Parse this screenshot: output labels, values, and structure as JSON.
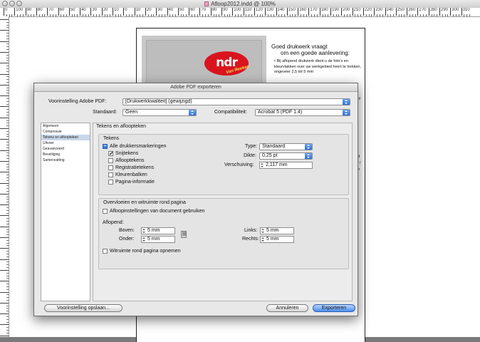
{
  "window": {
    "title": "Afloop2012.indd @ 100%"
  },
  "ruler": {
    "labels": [
      "0",
      "100",
      "90",
      "80",
      "70",
      "60",
      "50",
      "40",
      "30",
      "20",
      "10",
      "0",
      "10",
      "20",
      "30",
      "40",
      "50",
      "60",
      "70",
      "80",
      "90",
      "100",
      "110",
      "120",
      "130",
      "140",
      "150",
      "160",
      "170",
      "180",
      "190",
      "200",
      "210",
      "220",
      "230",
      "240",
      "250",
      "260",
      "270",
      "280",
      "290",
      "300",
      "310"
    ]
  },
  "document": {
    "heading_line1": "Goed drukwerk vraagt",
    "heading_line2": "om een goede aanlevering:",
    "body": "• Bij aflopend drukwerk dient u de foto's en kleurvlakken over uw werkgebied heen te trekken, ongeveer 2,5 tot 5 mm",
    "logo_text": "ndr",
    "logo_sub": "Van Reeken",
    "edge_fragments": [
      "n!",
      "d",
      "f /",
      "n"
    ]
  },
  "dialog": {
    "title": "Adobe PDF exporteren",
    "preset_label": "Voorinstelling Adobe PDF:",
    "preset_value": "[Drukwerkkwaliteit] (gewijzigd)",
    "standard_label": "Standaard:",
    "standard_value": "Geen",
    "compat_label": "Compatibiliteit:",
    "compat_value": "Acrobat 5 (PDF 1.4)",
    "sidebar": [
      "Algemeen",
      "Compressie",
      "Tekens en afloopteken",
      "Uitvoer",
      "Geavanceerd",
      "Beveiliging",
      "Samenvatting"
    ],
    "selected_sidebar_index": 2,
    "section_title": "Tekens en afloopteken",
    "marks": {
      "group_title": "Tekens",
      "all_marks": "Alle drukkersmarkeringen",
      "crop_marks": "Snijtekens",
      "bleed_marks": "Aflooptekens",
      "registration": "Registratietekens",
      "color_bars": "Kleurenbalken",
      "page_info": "Pagina-informatie",
      "type_label": "Type:",
      "type_value": "Standaard",
      "weight_label": "Dikte:",
      "weight_value": "0,25 pt",
      "offset_label": "Verschuiving:",
      "offset_value": "2,117 mm"
    },
    "bleed": {
      "group_title": "Overvloeien en witruimte rond pagina",
      "use_doc": "Afloopinstellingen van document gebruiken",
      "bleed_label": "Aflopend:",
      "top_label": "Boven:",
      "top_value": "5 mm",
      "bottom_label": "Onder:",
      "bottom_value": "5 mm",
      "left_label": "Links:",
      "left_value": "5 mm",
      "right_label": "Rechts:",
      "right_value": "5 mm",
      "slug": "Witruimte rond pagina opnemen"
    },
    "buttons": {
      "save_preset": "Voorinstelling opslaan...",
      "cancel": "Annuleren",
      "export": "Exporteren"
    }
  }
}
